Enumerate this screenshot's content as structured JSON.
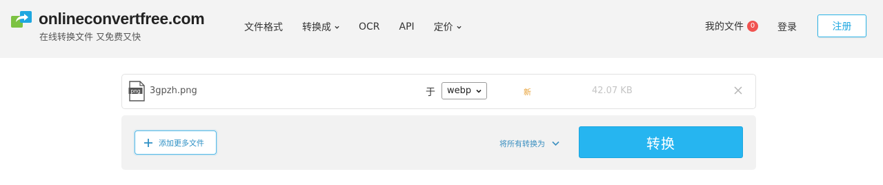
{
  "brand": {
    "name": "onlineconvertfree.com",
    "tagline": "在线转换文件 又免费又快",
    "colors": {
      "accent": "#26b5f0",
      "logo_green": "#7cc242",
      "logo_blue": "#1ea7e0",
      "badge": "#f05350"
    }
  },
  "nav": {
    "items": [
      {
        "label": "文件格式",
        "has_dropdown": false
      },
      {
        "label": "转换成",
        "has_dropdown": true
      },
      {
        "label": "OCR",
        "has_dropdown": false
      },
      {
        "label": "API",
        "has_dropdown": false
      },
      {
        "label": "定价",
        "has_dropdown": true
      }
    ]
  },
  "account": {
    "my_files_label": "我的文件",
    "my_files_count": "0",
    "login_label": "登录",
    "register_label": "注册"
  },
  "file": {
    "icon": "png-file-icon",
    "icon_text": "png",
    "name": "3gpzh.png",
    "to_label": "于",
    "target_format": "webp",
    "status": "新",
    "size": "42.07 KB"
  },
  "actions": {
    "add_files_label": "添加更多文件",
    "convert_all_label": "将所有转换为",
    "convert_label": "转换"
  }
}
